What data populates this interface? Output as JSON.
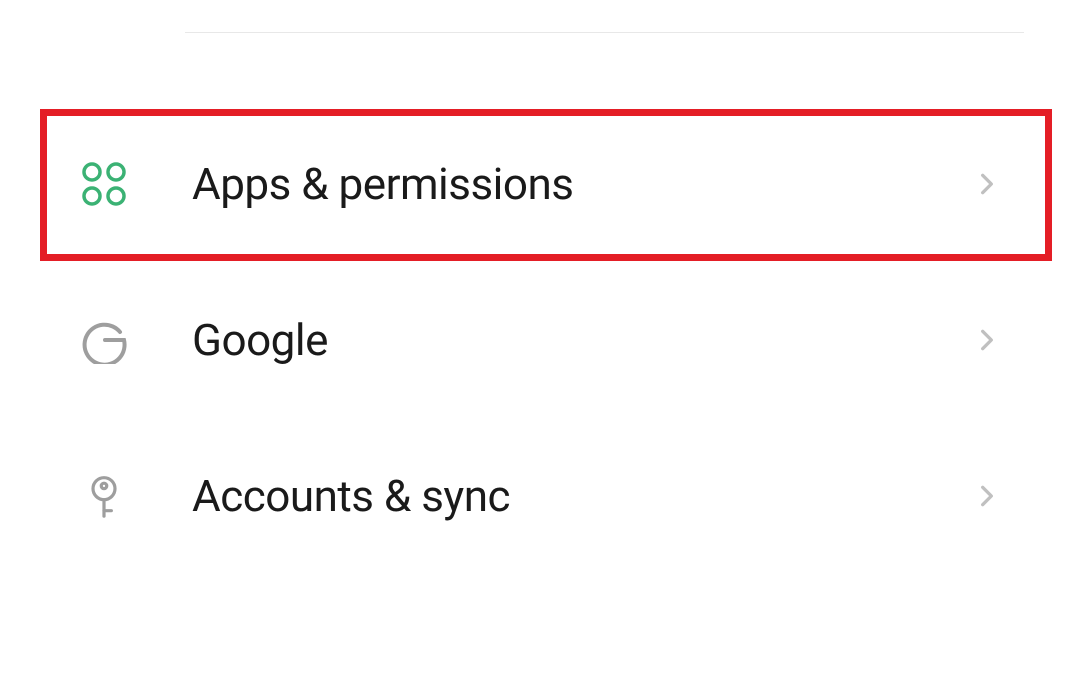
{
  "settings": {
    "items": [
      {
        "label": "Apps & permissions",
        "icon": "apps-icon",
        "highlighted": true
      },
      {
        "label": "Google",
        "icon": "google-icon",
        "highlighted": false
      },
      {
        "label": "Accounts & sync",
        "icon": "key-icon",
        "highlighted": false
      }
    ]
  }
}
